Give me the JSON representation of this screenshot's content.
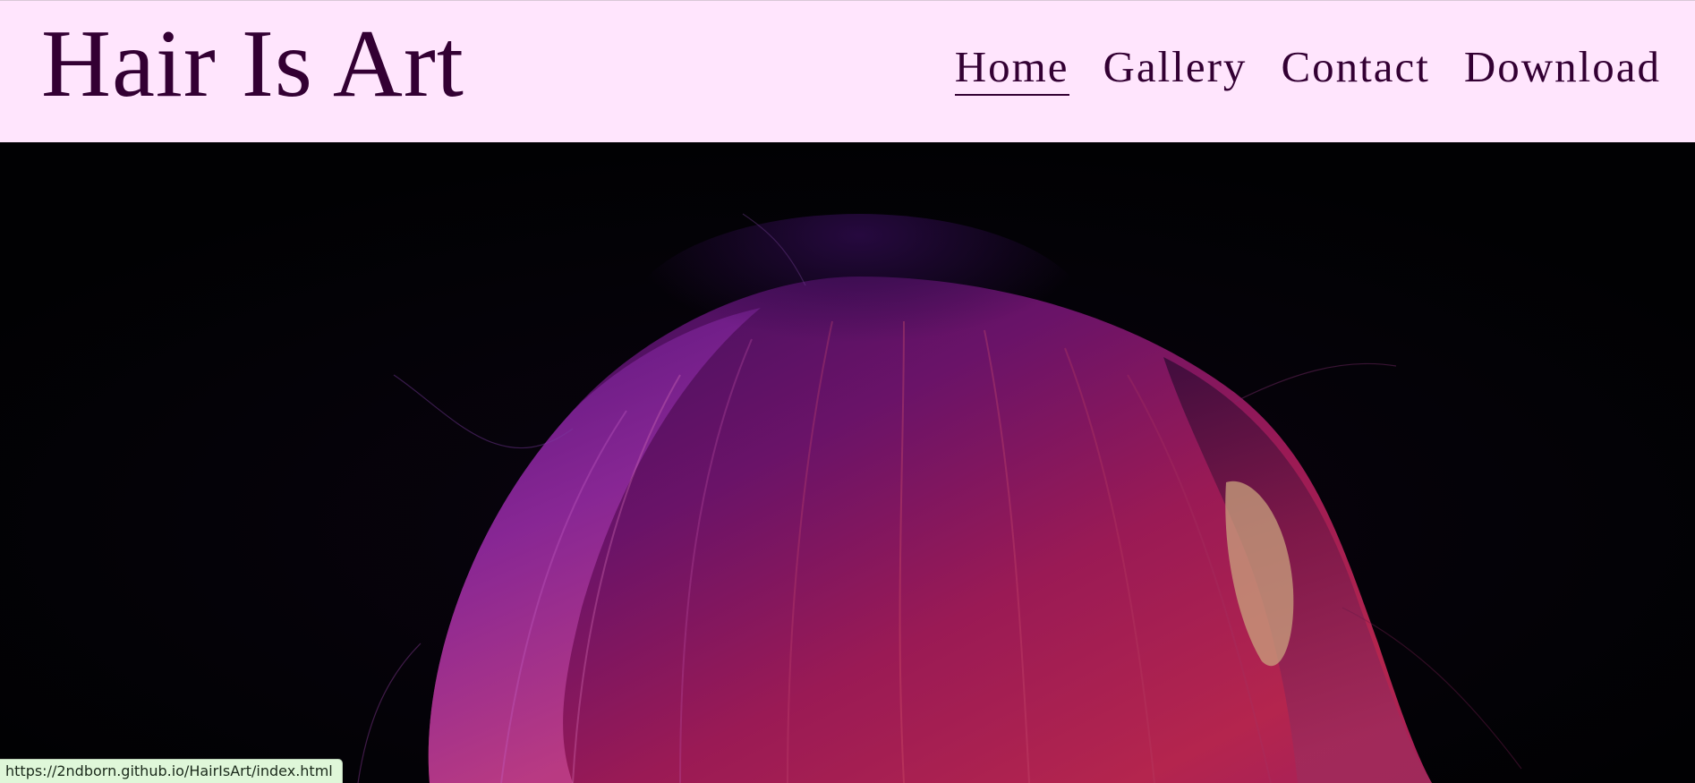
{
  "site": {
    "title": "Hair Is Art"
  },
  "nav": {
    "items": [
      {
        "label": "Home",
        "active": true
      },
      {
        "label": "Gallery",
        "active": false
      },
      {
        "label": "Contact",
        "active": false
      },
      {
        "label": "Download",
        "active": false
      }
    ]
  },
  "hero": {
    "image_subject": "purple-and-red-dyed-hair-on-black-background"
  },
  "status_bar": {
    "url": "https://2ndborn.github.io/HairIsArt/index.html"
  },
  "colors": {
    "header_bg": "#ffe5fd",
    "text": "#330033",
    "hero_bg": "#020204",
    "status_bg": "#dff7d9"
  }
}
